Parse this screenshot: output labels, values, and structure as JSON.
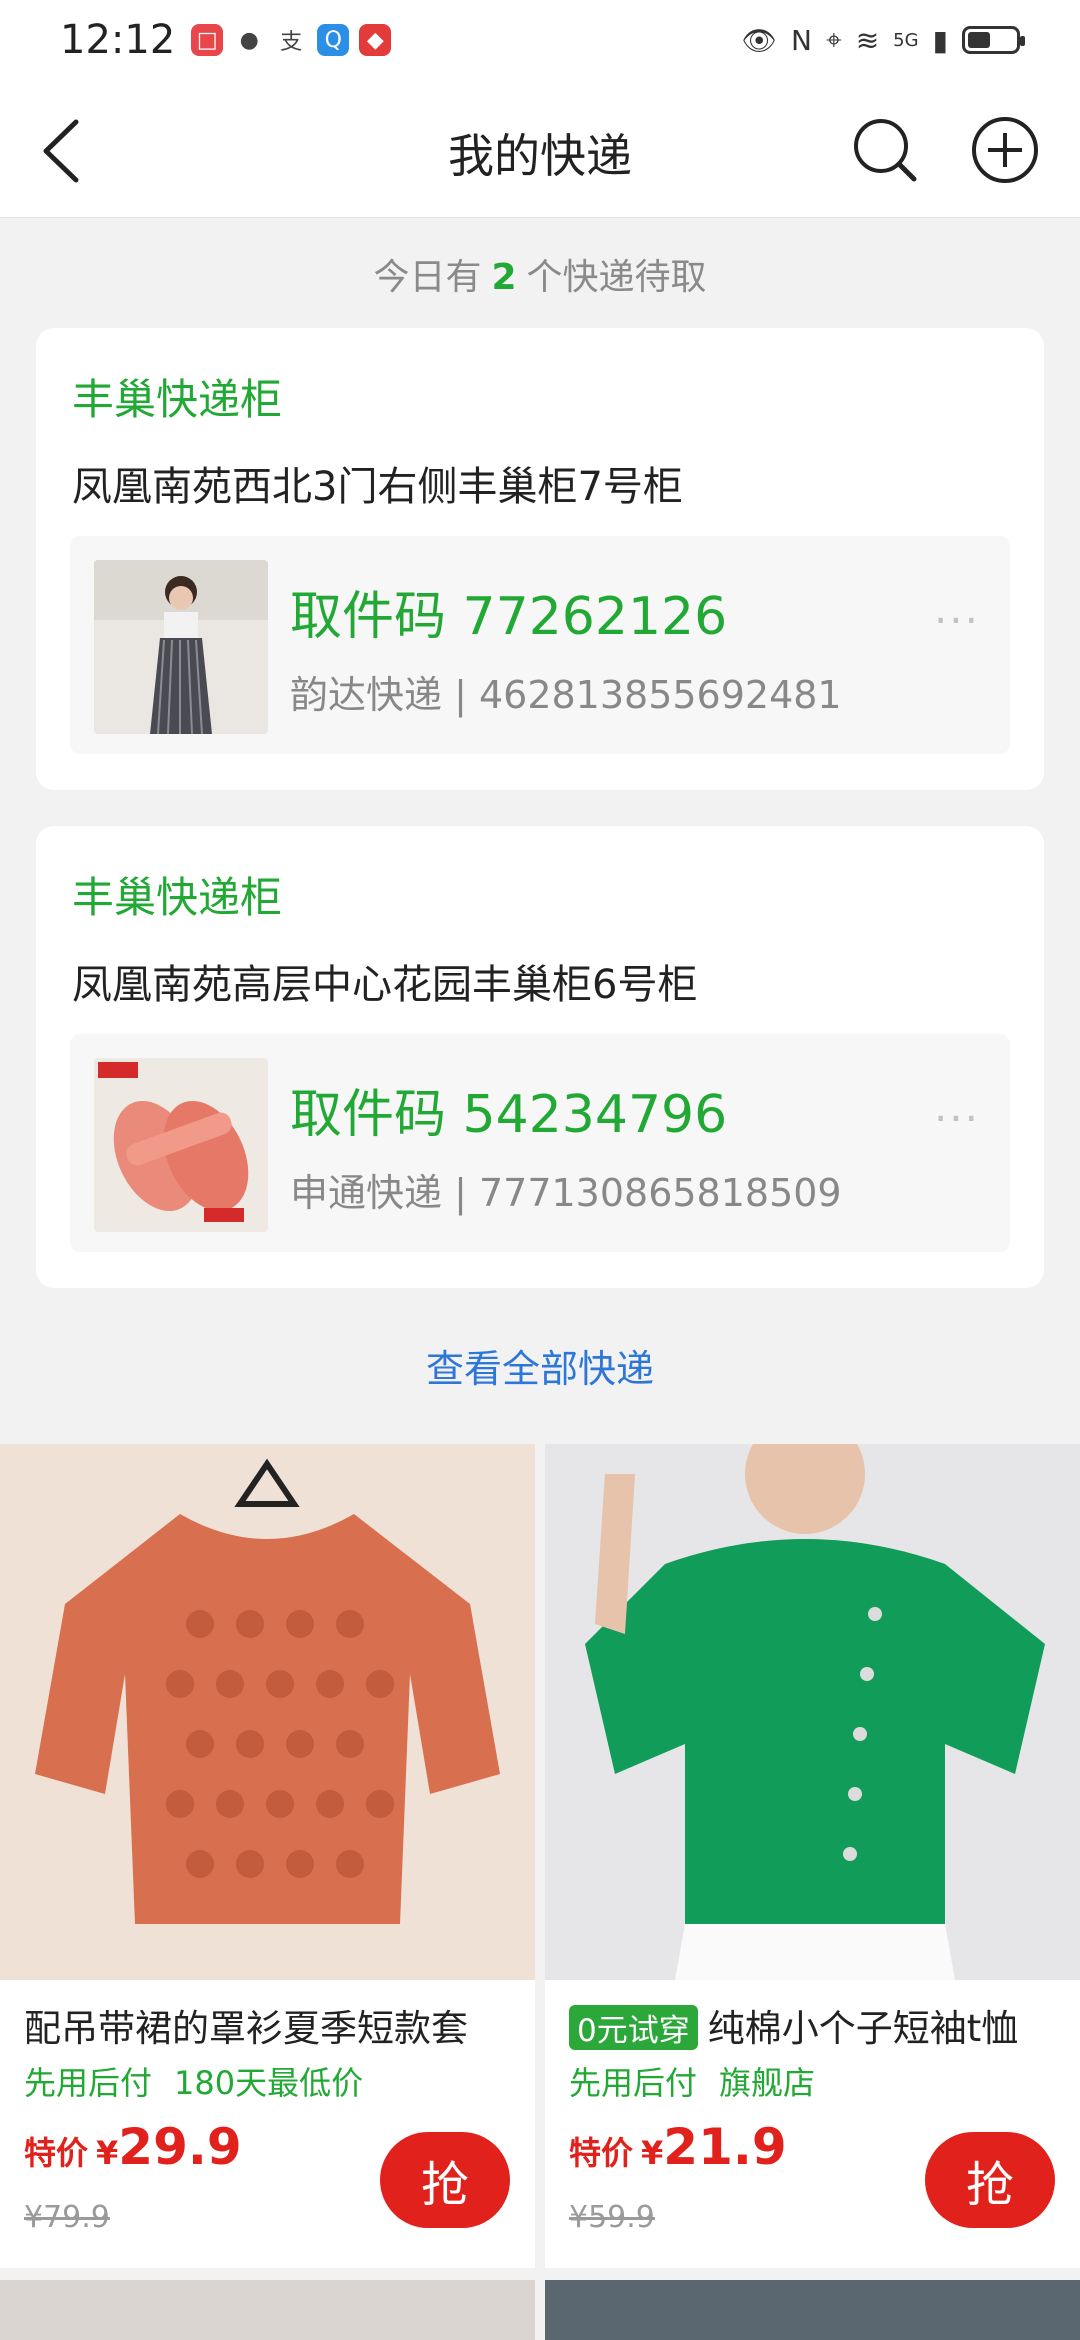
{
  "status_bar": {
    "time": "12:12",
    "network": "5G"
  },
  "nav": {
    "title": "我的快递"
  },
  "summary": {
    "prefix": "今日有",
    "count": "2",
    "suffix": "个快递待取"
  },
  "parcels": [
    {
      "type": "丰巢快递柜",
      "location": "凤凰南苑西北3门右侧丰巢柜7号柜",
      "code": "取件码 77262126",
      "carrier": "韵达快递 | 462813855692481",
      "more": "···"
    },
    {
      "type": "丰巢快递柜",
      "location": "凤凰南苑高层中心花园丰巢柜6号柜",
      "code": "取件码 54234796",
      "carrier": "申通快递 | 777130865818509",
      "more": "···"
    }
  ],
  "view_all": "查看全部快递",
  "products": [
    {
      "title": "配吊带裙的罩衫夏季短款套",
      "tag": "",
      "sub": [
        "先用后付",
        "180天最低价"
      ],
      "price_label": "特价",
      "currency": "¥",
      "price": "29.9",
      "original_price": "¥79.9",
      "button": "抢"
    },
    {
      "title": "纯棉小个子短袖t恤",
      "tag": "0元试穿",
      "sub": [
        "先用后付",
        "旗舰店"
      ],
      "price_label": "特价",
      "currency": "¥",
      "price": "21.9",
      "original_price": "¥59.9",
      "button": "抢"
    }
  ],
  "colors": {
    "accent_green": "#22a834",
    "price_red": "#e1211b",
    "link_blue": "#2f77d6"
  }
}
